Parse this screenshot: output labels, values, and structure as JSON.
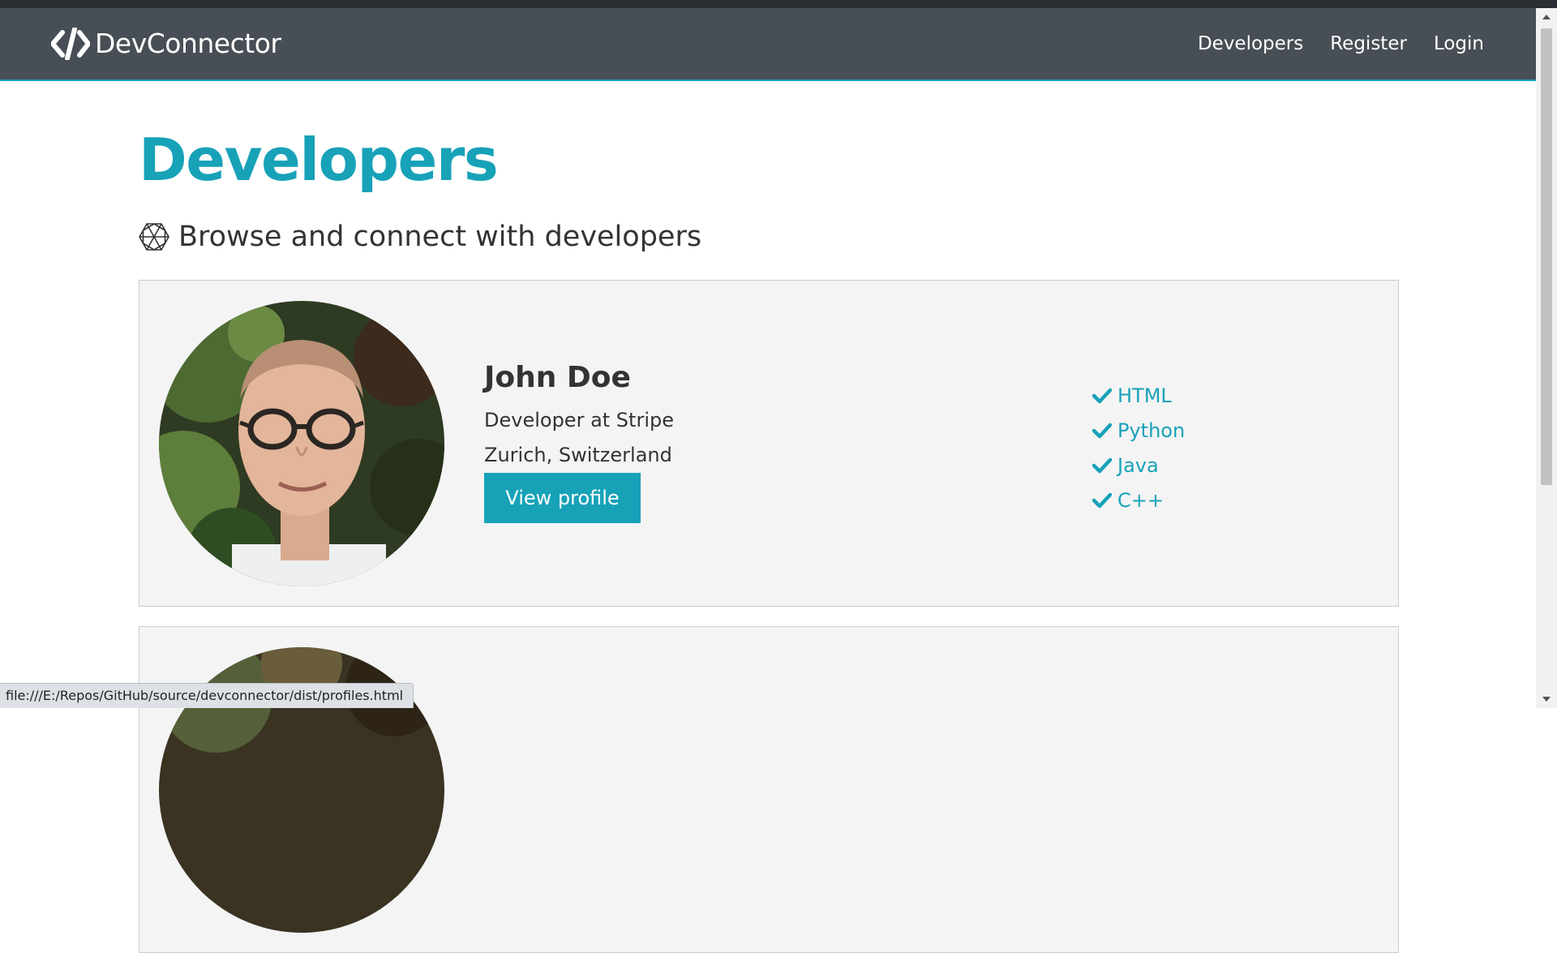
{
  "navbar": {
    "brand": "DevConnector",
    "brand_icon": "code-icon",
    "links": [
      "Developers",
      "Register",
      "Login"
    ]
  },
  "page": {
    "title": "Developers",
    "lead": "Browse and connect with developers",
    "lead_icon": "connect-develop-icon"
  },
  "profiles": [
    {
      "name": "John Doe",
      "role": "Developer at Stripe",
      "location": "Zurich, Switzerland",
      "button_label": "View profile",
      "skills": [
        "HTML",
        "Python",
        "Java",
        "C++"
      ]
    }
  ],
  "status_bar": {
    "url": "file:///E:/Repos/GitHub/source/devconnector/dist/profiles.html"
  },
  "colors": {
    "primary": "#17a2b8",
    "navbar": "#484e55",
    "card_background": "#f4f4f4"
  }
}
